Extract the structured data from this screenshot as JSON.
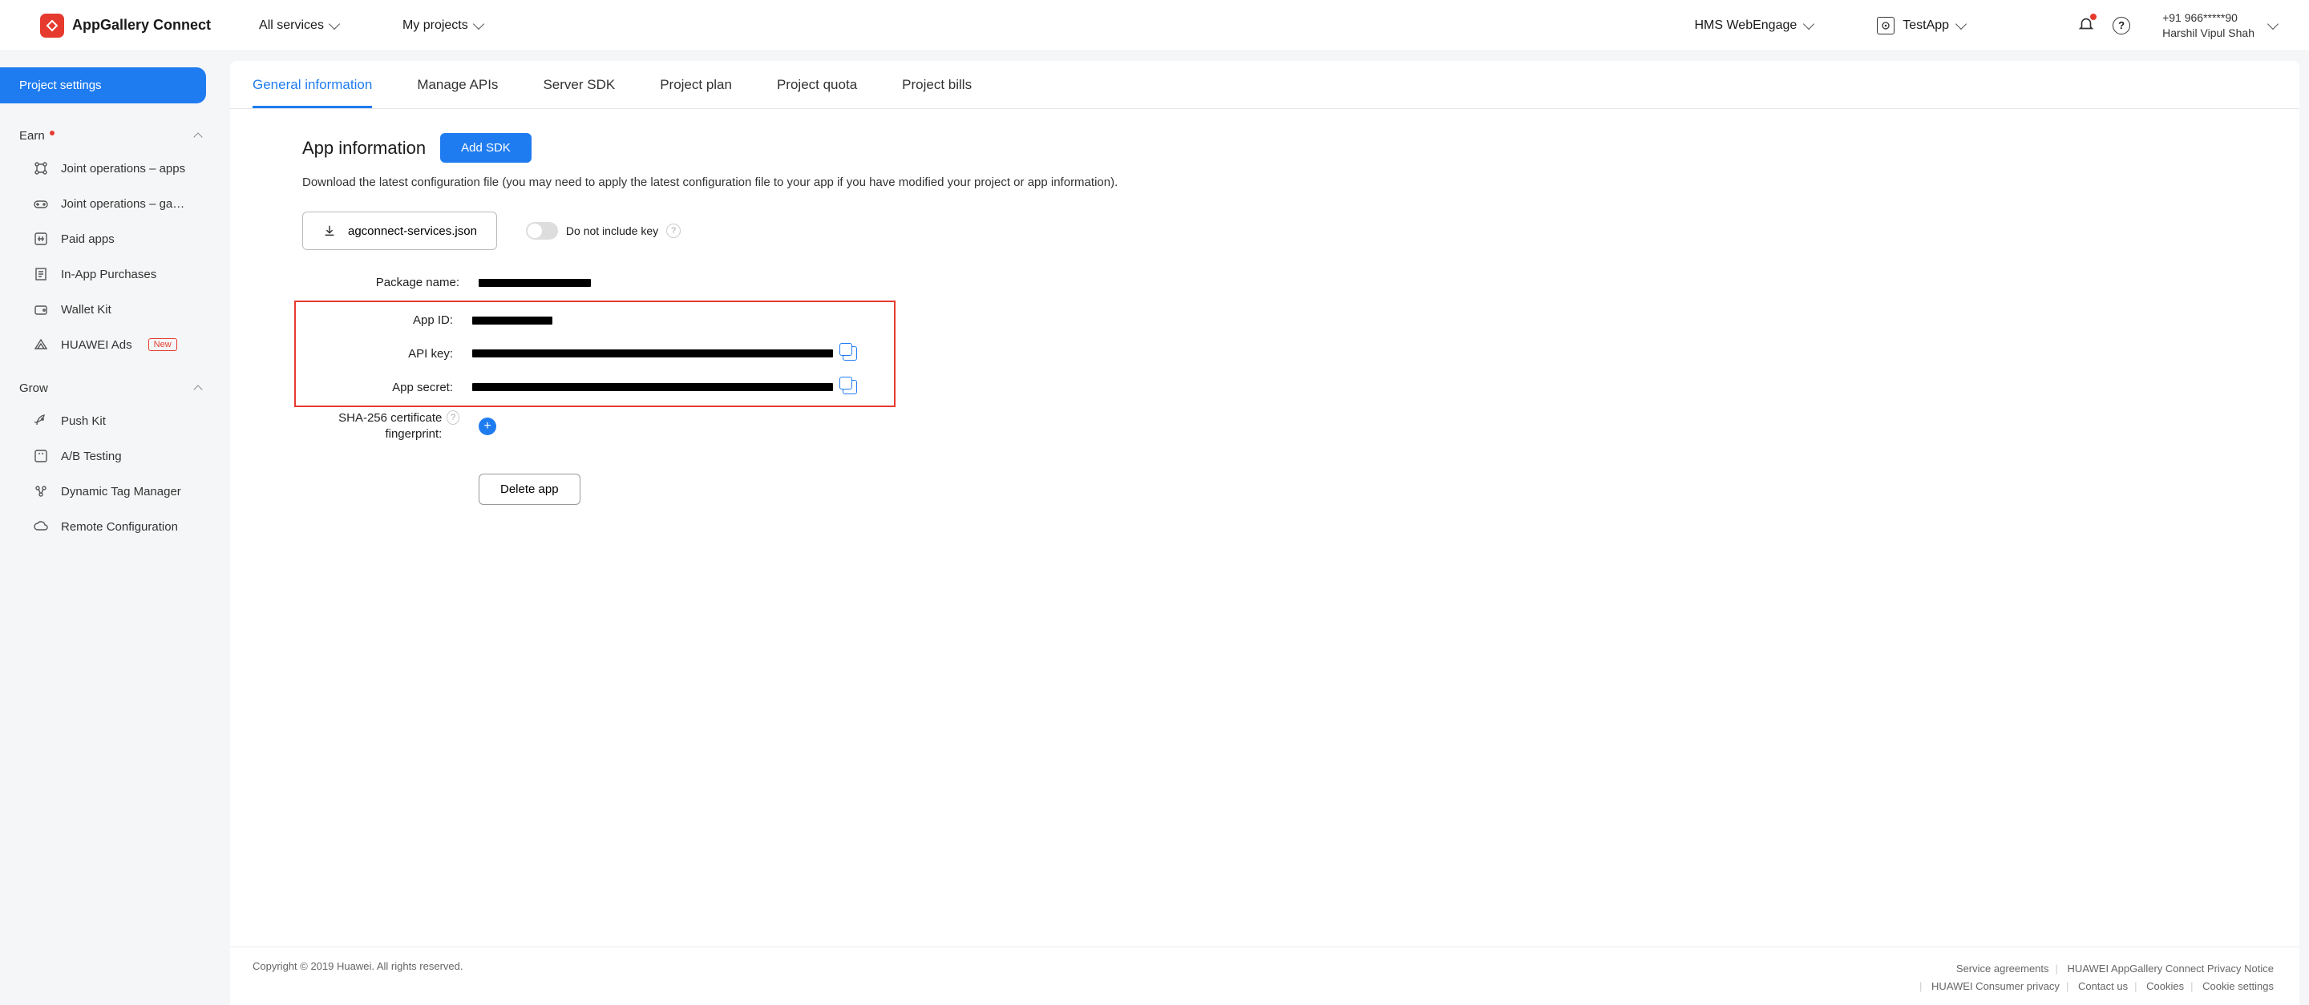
{
  "header": {
    "brand": "AppGallery Connect",
    "nav_all_services": "All services",
    "nav_my_projects": "My projects",
    "project_name": "HMS WebEngage",
    "app_name": "TestApp",
    "user_phone": "+91 966*****90",
    "user_name": "Harshil Vipul Shah"
  },
  "sidebar": {
    "active": "Project settings",
    "earn_label": "Earn",
    "earn_items": [
      "Joint operations – apps",
      "Joint operations – ga…",
      "Paid apps",
      "In-App Purchases",
      "Wallet Kit",
      "HUAWEI Ads"
    ],
    "new_badge": "New",
    "grow_label": "Grow",
    "grow_items": [
      "Push Kit",
      "A/B Testing",
      "Dynamic Tag Manager",
      "Remote Configuration"
    ]
  },
  "tabs": [
    "General information",
    "Manage APIs",
    "Server SDK",
    "Project plan",
    "Project quota",
    "Project bills"
  ],
  "section": {
    "title": "App information",
    "add_sdk": "Add SDK",
    "desc": "Download the latest configuration file (you may need to apply the latest configuration file to your app if you have modified your project or app information).",
    "download_file": "agconnect-services.json",
    "toggle_label": "Do not include key",
    "labels": {
      "package": "Package name:",
      "app_id": "App ID:",
      "api_key": "API key:",
      "app_secret": "App secret:",
      "sha": "SHA-256 certificate fingerprint:"
    },
    "delete_btn": "Delete app"
  },
  "footer": {
    "copyright": "Copyright © 2019 Huawei. All rights reserved.",
    "links": [
      "Service agreements",
      "HUAWEI AppGallery Connect Privacy Notice",
      "HUAWEI Consumer privacy",
      "Contact us",
      "Cookies",
      "Cookie settings"
    ]
  }
}
